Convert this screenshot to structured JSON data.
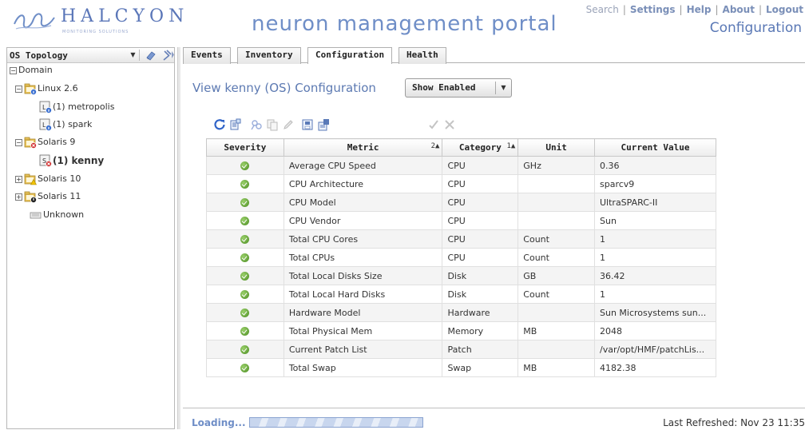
{
  "header": {
    "logo_name": "HALCYON",
    "logo_tagline": "MONITORING SOLUTIONS",
    "portal_title": "neuron management portal",
    "links": [
      {
        "label": "Search"
      },
      {
        "label": "Settings"
      },
      {
        "label": "Help"
      },
      {
        "label": "About"
      },
      {
        "label": "Logout"
      }
    ],
    "section": "Configuration"
  },
  "sidebar": {
    "title": "OS Topology",
    "tree": [
      {
        "label": "Domain",
        "expander": "⊟",
        "icon": "none"
      },
      {
        "label": "Linux 2.6",
        "expander": "⊟",
        "icon": "folder-info-icon"
      },
      {
        "label": "(1) metropolis",
        "icon": "host-info-icon"
      },
      {
        "label": "(1) spark",
        "icon": "host-info-icon"
      },
      {
        "label": "Solaris 9",
        "expander": "⊟",
        "icon": "folder-error-icon"
      },
      {
        "label": "(1) kenny",
        "icon": "host-error-icon"
      },
      {
        "label": "Solaris 10",
        "expander": "⊞",
        "icon": "folder-warning-icon"
      },
      {
        "label": "Solaris 11",
        "expander": "⊞",
        "icon": "folder-critical-icon"
      },
      {
        "label": "Unknown",
        "icon": "unknown-icon"
      }
    ]
  },
  "tabs": [
    {
      "label": "Events"
    },
    {
      "label": "Inventory"
    },
    {
      "label": "Configuration",
      "active": true
    },
    {
      "label": "Health"
    }
  ],
  "main": {
    "title": "View kenny (OS) Configuration",
    "filter": {
      "selected": "Show Enabled"
    },
    "toolbar_icons": [
      "refresh-icon",
      "export-icon",
      "find-icon",
      "copy-icon",
      "edit-icon",
      "save-icon",
      "properties-icon",
      "apply-icon",
      "cancel-icon"
    ],
    "table": {
      "columns": [
        {
          "label": "Severity"
        },
        {
          "label": "Metric",
          "sort": "2▲"
        },
        {
          "label": "Category",
          "sort": "1▲"
        },
        {
          "label": "Unit"
        },
        {
          "label": "Current Value"
        }
      ],
      "rows": [
        {
          "metric": "Average CPU Speed",
          "category": "CPU",
          "unit": "GHz",
          "value": "0.36"
        },
        {
          "metric": "CPU Architecture",
          "category": "CPU",
          "unit": "",
          "value": "sparcv9"
        },
        {
          "metric": "CPU Model",
          "category": "CPU",
          "unit": "",
          "value": "UltraSPARC-II"
        },
        {
          "metric": "CPU Vendor",
          "category": "CPU",
          "unit": "",
          "value": "Sun"
        },
        {
          "metric": "Total CPU Cores",
          "category": "CPU",
          "unit": "Count",
          "value": "1"
        },
        {
          "metric": "Total CPUs",
          "category": "CPU",
          "unit": "Count",
          "value": "1"
        },
        {
          "metric": "Total Local Disks Size",
          "category": "Disk",
          "unit": "GB",
          "value": "36.42"
        },
        {
          "metric": "Total Local Hard Disks",
          "category": "Disk",
          "unit": "Count",
          "value": "1"
        },
        {
          "metric": "Hardware Model",
          "category": "Hardware",
          "unit": "",
          "value": "Sun Microsystems sun..."
        },
        {
          "metric": "Total Physical Mem",
          "category": "Memory",
          "unit": "MB",
          "value": "2048"
        },
        {
          "metric": "Current Patch List",
          "category": "Patch",
          "unit": "",
          "value": "/var/opt/HMF/patchLis..."
        },
        {
          "metric": "Total Swap",
          "category": "Swap",
          "unit": "MB",
          "value": "4182.38"
        }
      ]
    }
  },
  "footer": {
    "status": "Loading...",
    "last_refreshed": "Last Refreshed: Nov 23 11:35"
  },
  "colors": {
    "accent": "#6f8ec7",
    "ok": "#5aa02c",
    "error": "#d03030",
    "warning": "#e8b000",
    "info": "#3a6fd0"
  }
}
